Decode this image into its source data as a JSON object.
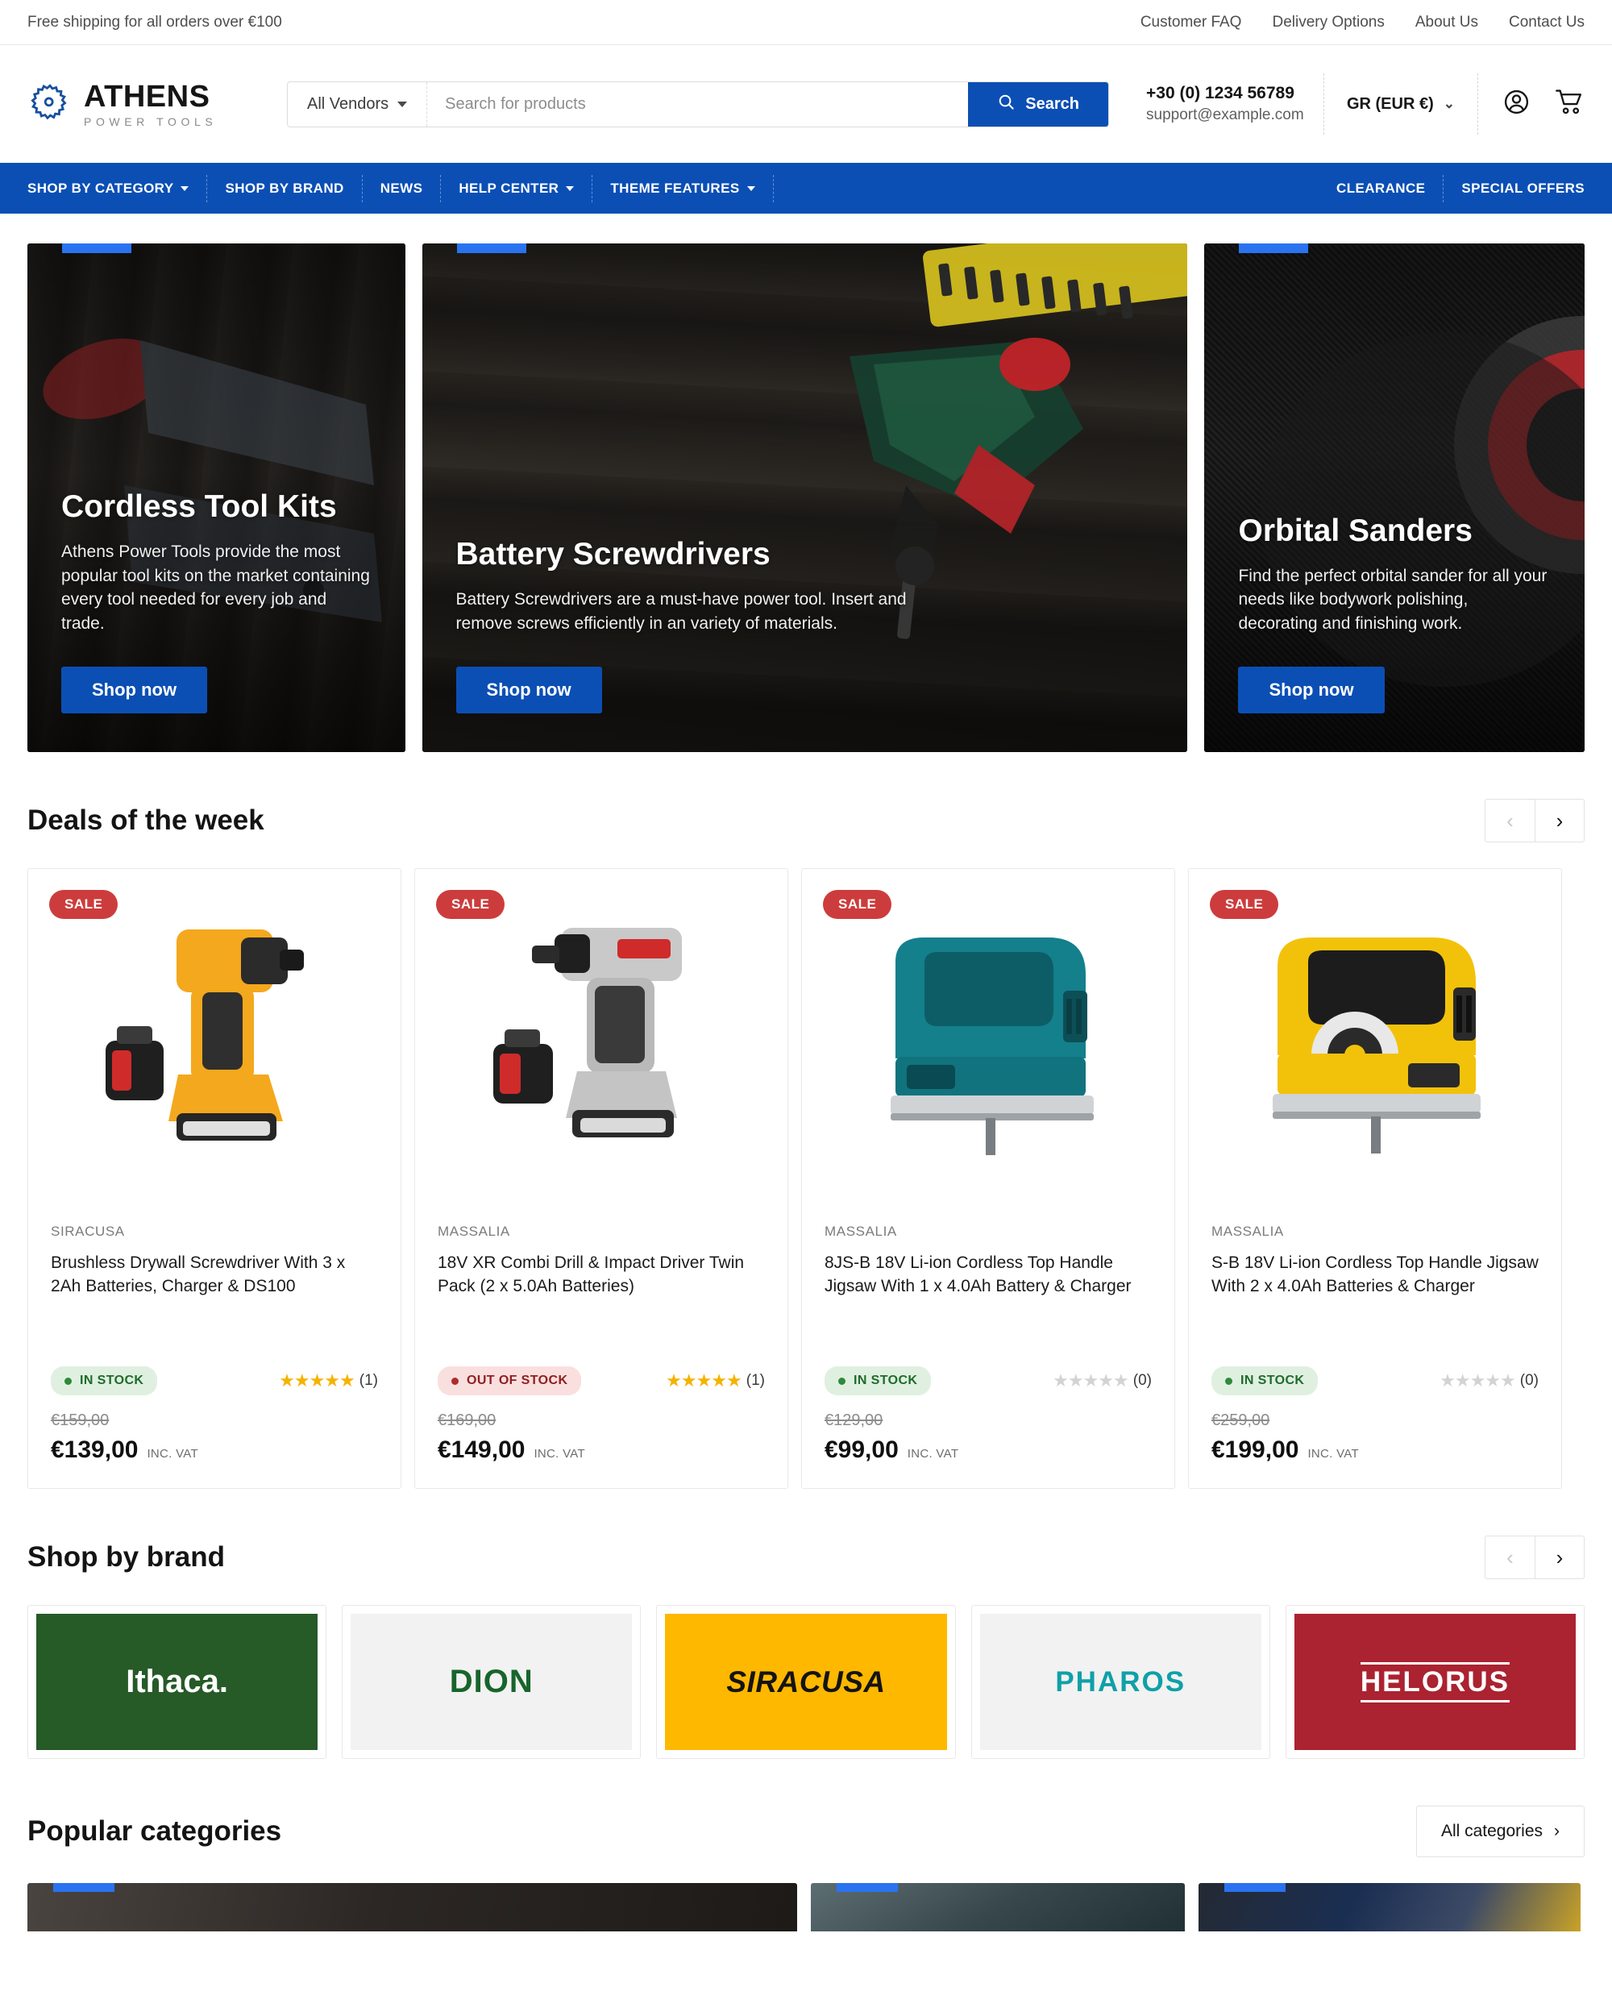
{
  "topbar": {
    "promo": "Free shipping for all orders over €100",
    "links": [
      "Customer FAQ",
      "Delivery Options",
      "About Us",
      "Contact Us"
    ]
  },
  "header": {
    "logo_main": "ATHENS",
    "logo_sub": "POWER TOOLS",
    "logo_icon": "gear-icon",
    "vendor_label": "All Vendors",
    "search_placeholder": "Search for products",
    "search_value": "",
    "search_button": "Search",
    "search_icon": "search-icon",
    "phone": "+30 (0) 1234 56789",
    "email": "support@example.com",
    "currency": "GR (EUR €)",
    "account_icon": "user-account-icon",
    "cart_icon": "shopping-cart-icon"
  },
  "mainnav": {
    "left": [
      {
        "label": "SHOP BY CATEGORY",
        "caret": true
      },
      {
        "label": "SHOP BY BRAND",
        "caret": false
      },
      {
        "label": "NEWS",
        "caret": false
      },
      {
        "label": "HELP CENTER",
        "caret": true
      },
      {
        "label": "THEME FEATURES",
        "caret": true
      }
    ],
    "right": [
      {
        "label": "CLEARANCE",
        "caret": false
      },
      {
        "label": "SPECIAL OFFERS",
        "caret": false
      }
    ]
  },
  "hero": {
    "banners": [
      {
        "title": "Cordless Tool Kits",
        "desc": "Athens Power Tools provide the most popular tool kits on the market containing every tool needed for every job and trade.",
        "cta": "Shop now"
      },
      {
        "title": "Battery Screwdrivers",
        "desc": "Battery Screwdrivers are a must-have power tool. Insert and remove screws efficiently in an variety of materials.",
        "cta": "Shop now"
      },
      {
        "title": "Orbital Sanders",
        "desc": "Find the perfect orbital sander for all your needs like bodywork polishing, decorating and finishing work.",
        "cta": "Shop now"
      }
    ]
  },
  "deals": {
    "title": "Deals of the week",
    "prev_icon": "chevron-left-icon",
    "next_icon": "chevron-right-icon",
    "vat_label": "INC. VAT",
    "products": [
      {
        "badge": "SALE",
        "brand": "SIRACUSA",
        "title": "Brushless Drywall Screwdriver With 3 x 2Ah Batteries, Charger & DS100",
        "stock": "IN STOCK",
        "stock_state": "in",
        "rating": 5,
        "reviews": "(1)",
        "old_price": "€159,00",
        "price": "€139,00"
      },
      {
        "badge": "SALE",
        "brand": "MASSALIA",
        "title": "18V XR Combi Drill & Impact Driver Twin Pack (2 x 5.0Ah Batteries)",
        "stock": "OUT OF STOCK",
        "stock_state": "out",
        "rating": 5,
        "reviews": "(1)",
        "old_price": "€169,00",
        "price": "€149,00"
      },
      {
        "badge": "SALE",
        "brand": "MASSALIA",
        "title": "8JS-B 18V Li-ion Cordless Top Handle Jigsaw With 1 x 4.0Ah Battery & Charger",
        "stock": "IN STOCK",
        "stock_state": "in",
        "rating": 0,
        "reviews": "(0)",
        "old_price": "€129,00",
        "price": "€99,00"
      },
      {
        "badge": "SALE",
        "brand": "MASSALIA",
        "title": "S-B 18V Li-ion Cordless Top Handle Jigsaw With 2 x 4.0Ah Batteries & Charger",
        "stock": "IN STOCK",
        "stock_state": "in",
        "rating": 0,
        "reviews": "(0)",
        "old_price": "€259,00",
        "price": "€199,00"
      }
    ]
  },
  "brands": {
    "title": "Shop by brand",
    "prev_icon": "chevron-left-icon",
    "next_icon": "chevron-right-icon",
    "items": [
      {
        "name": "Ithaca.",
        "style": "ithaca",
        "bg": "#265a27",
        "fg": "#ffffff"
      },
      {
        "name": "DION",
        "style": "dion",
        "bg": "#f2f2f2",
        "fg": "#17652b"
      },
      {
        "name": "SIRACUSA",
        "style": "siracusa",
        "bg": "#ffb800",
        "fg": "#141414"
      },
      {
        "name": "PHAROS",
        "style": "pharos",
        "bg": "#f2f2f2",
        "fg": "#0fa0a8"
      },
      {
        "name": "HELORUS",
        "style": "helorus",
        "bg": "#ab2230",
        "fg": "#ffffff"
      }
    ]
  },
  "categories": {
    "title": "Popular categories",
    "all_button": "All categories",
    "all_button_icon": "chevron-right-icon"
  },
  "colors": {
    "brand_blue": "#0b4fb5",
    "accent_blue": "#2a73f0",
    "sale_red": "#cd3c3c",
    "in_stock_green": "#1f6b2b",
    "out_stock_red": "#8f2020",
    "star_gold": "#f5b300"
  }
}
